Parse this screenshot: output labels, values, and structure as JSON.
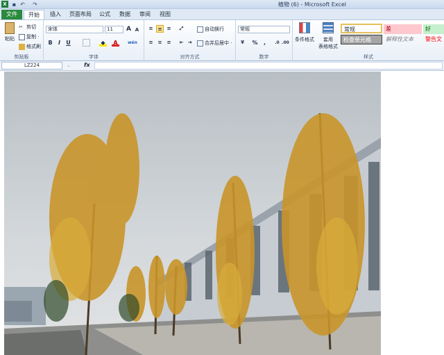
{
  "window": {
    "title": "植物 (6)  -  Microsoft Excel",
    "app_icon": "excel-icon"
  },
  "tabs": [
    {
      "label": "文件"
    },
    {
      "label": "开始"
    },
    {
      "label": "插入"
    },
    {
      "label": "页面布局"
    },
    {
      "label": "公式"
    },
    {
      "label": "数据"
    },
    {
      "label": "审阅"
    },
    {
      "label": "视图"
    }
  ],
  "ribbon": {
    "clipboard": {
      "paste": "粘贴",
      "cut": "剪切",
      "copy": "复制 ·",
      "format_painter": "格式刷",
      "label": "剪贴板"
    },
    "font": {
      "name": "宋体",
      "size": "11",
      "bold": "B",
      "italic": "I",
      "underline": "U",
      "label": "字体",
      "grow": "A",
      "shrink": "A",
      "phonetic": "wén"
    },
    "alignment": {
      "wrap": "自动换行",
      "merge": "合并后居中 ·",
      "label": "对齐方式"
    },
    "number": {
      "format": "常规",
      "percent": "%",
      "comma": ",",
      "label": "数字"
    },
    "styles": {
      "conditional": "条件格式",
      "table": "套用",
      "table2": "表格格式",
      "normal": "常规",
      "bad": "差",
      "good": "好",
      "check": "检查单元格",
      "explanatory": "解释性文本",
      "warning": "警告文本",
      "label": "样式"
    }
  },
  "formula_bar": {
    "cell": "LZ224",
    "fx": "fx",
    "value": ""
  },
  "colors": {
    "file_tab": "#2a8a3e",
    "ribbon_bg": "#e8eff8",
    "sky": "#c9cfd3",
    "foliage": "#c9952a"
  }
}
